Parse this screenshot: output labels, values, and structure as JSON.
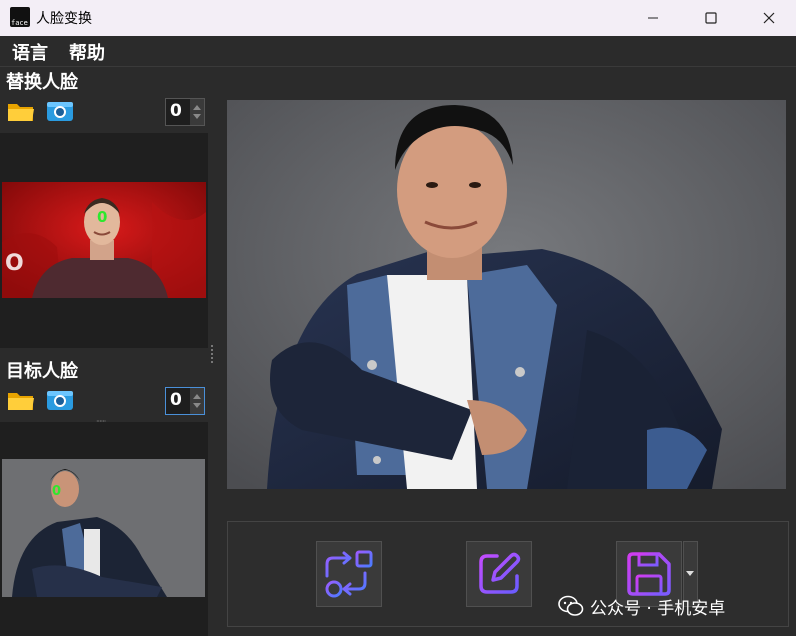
{
  "window": {
    "title": "人脸变换",
    "icon_label": "face",
    "controls": [
      "minimize-icon",
      "maximize-icon",
      "close-icon"
    ]
  },
  "menu": {
    "items": [
      {
        "label": "语言"
      },
      {
        "label": "帮助"
      }
    ]
  },
  "source_panel": {
    "title": "替换人脸",
    "face_index": "0",
    "face_marker": "0",
    "icons": [
      "folder-icon",
      "camera-icon"
    ]
  },
  "target_panel": {
    "title": "目标人脸",
    "face_index": "0",
    "face_marker": "0",
    "icons": [
      "folder-icon",
      "camera-icon"
    ]
  },
  "toolbar": {
    "buttons": [
      {
        "icon": "swap-icon"
      },
      {
        "icon": "edit-icon"
      },
      {
        "icon": "save-icon"
      }
    ]
  },
  "watermark": {
    "text": "公众号 · 手机安卓",
    "icon": "wechat-icon"
  },
  "colors": {
    "background": "#2b2b2b",
    "titlebar": "#f3eef6",
    "accent_gradient_start": "#6a5cff",
    "accent_gradient_end": "#d23cf0",
    "face_marker": "#2ee82e"
  }
}
